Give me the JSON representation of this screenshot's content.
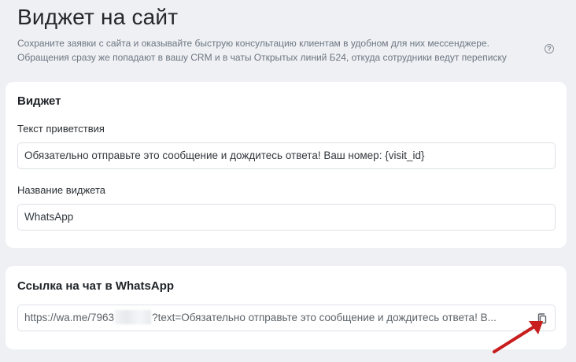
{
  "header": {
    "title": "Виджет на сайт",
    "description_line1": "Сохраните заявки с сайта и оказывайте быструю консультацию клиентам в удобном для них мессенджере.",
    "description_line2": "Обращения сразу же попадают в вашу CRM и в чаты Открытых линий Б24, откуда сотрудники ведут переписку",
    "help_icon": "question-circle-icon",
    "help_glyph": "?"
  },
  "widget": {
    "title": "Виджет",
    "greeting_label": "Текст приветствия",
    "greeting_value": "Обязательно отправьте это сообщение и дождитесь ответа! Ваш номер: {visit_id}",
    "name_label": "Название виджета",
    "name_value": "WhatsApp"
  },
  "chat_link": {
    "title": "Ссылка на чат в WhatsApp",
    "url_prefix": "https://wa.me/7963",
    "url_suffix": "?text=Обязательно отправьте это сообщение и дождитесь ответа! В...",
    "copy_icon": "copy-icon"
  },
  "colors": {
    "background": "#eef0f4",
    "card": "#ffffff",
    "border": "#dde1e7",
    "annotation_arrow": "#c81e1e"
  }
}
